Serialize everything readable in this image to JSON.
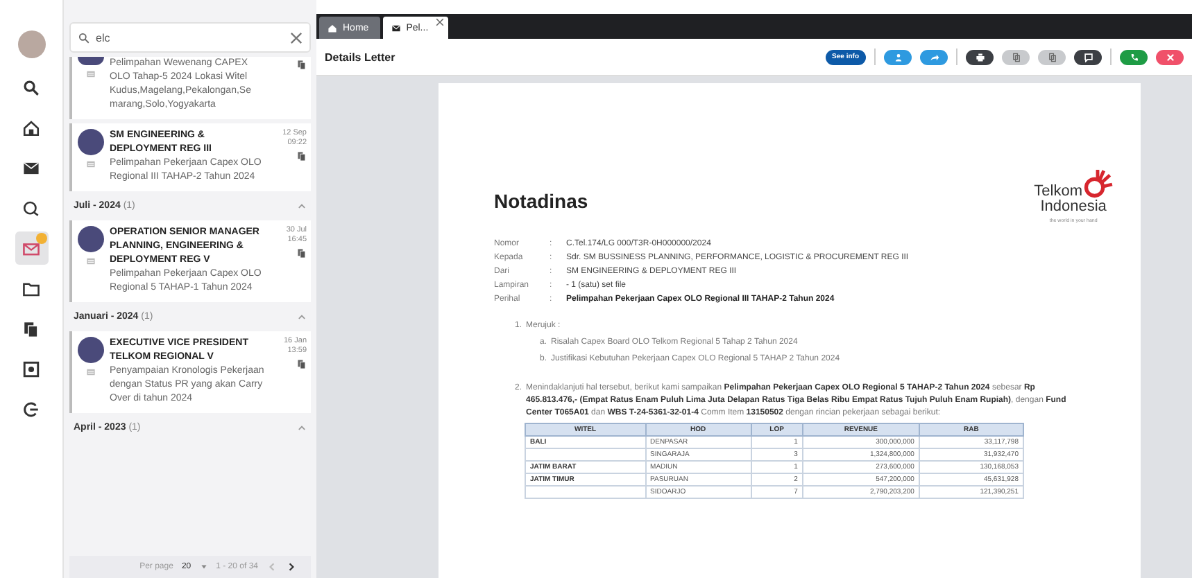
{
  "rail": {
    "items": [
      {
        "kind": "search",
        "selected": false,
        "badge": false
      },
      {
        "kind": "home",
        "selected": false,
        "badge": false
      },
      {
        "kind": "inbox",
        "selected": false,
        "badge": false
      },
      {
        "kind": "chat",
        "selected": false,
        "badge": false
      },
      {
        "kind": "mail",
        "selected": true,
        "badge": true
      },
      {
        "kind": "folder",
        "selected": false,
        "badge": false
      },
      {
        "kind": "copy",
        "selected": false,
        "badge": false
      },
      {
        "kind": "settings",
        "selected": false,
        "badge": false
      },
      {
        "kind": "logout",
        "selected": false,
        "badge": false
      }
    ]
  },
  "list": {
    "search": {
      "value": "elc"
    },
    "entries": [
      {
        "kind": "message",
        "subject": "Pelimpahan Wewenang CAPEX OLO Tahap-5 2024 Lokasi Witel Kudus,Magelang,Pekalongan,Se marang,Solo,Yogyakarta"
      },
      {
        "kind": "message",
        "sender": "SM ENGINEERING & DEPLOYMENT REG III",
        "date": "12 Sep",
        "time": "09:22",
        "subject": "Pelimpahan Pekerjaan Capex OLO Regional III TAHAP-2 Tahun 2024"
      },
      {
        "kind": "group",
        "label": "Juli - 2024",
        "count": "(1)",
        "expanded": true
      },
      {
        "kind": "message",
        "sender": "OPERATION SENIOR MANAGER PLANNING, ENGINEERING & DEPLOYMENT REG V",
        "date": "30 Jul",
        "time": "16:45",
        "subject": "Pelimpahan Pekerjaan Capex OLO Regional 5 TAHAP-1 Tahun 2024"
      },
      {
        "kind": "group",
        "label": "Januari - 2024",
        "count": "(1)",
        "expanded": true
      },
      {
        "kind": "message",
        "sender": "EXECUTIVE VICE PRESIDENT TELKOM REGIONAL V",
        "date": "16 Jan",
        "time": "13:59",
        "subject": "Penyampaian Kronologis Pekerjaan dengan Status PR yang akan Carry Over di tahun 2024"
      },
      {
        "kind": "group",
        "label": "April - 2023",
        "count": "(1)",
        "expanded": true
      }
    ],
    "pagination": {
      "label": "Per page",
      "per_page": "20",
      "range": "1 - 20 of 34"
    }
  },
  "tabs": [
    {
      "kind": "home",
      "label": "Home",
      "selected": false,
      "closable": false
    },
    {
      "kind": "letter",
      "label": "Pel...",
      "selected": true,
      "closable": true
    }
  ],
  "toolbar": {
    "title": "Details Letter",
    "buttons": [
      {
        "kind": "info",
        "label": "See info"
      },
      {
        "kind": "divider"
      },
      {
        "kind": "person"
      },
      {
        "kind": "forward"
      },
      {
        "kind": "divider"
      },
      {
        "kind": "print"
      },
      {
        "kind": "copy"
      },
      {
        "kind": "copy"
      },
      {
        "kind": "comment"
      },
      {
        "kind": "divider"
      },
      {
        "kind": "phone"
      },
      {
        "kind": "close"
      }
    ]
  },
  "document": {
    "title": "Notadinas",
    "logo": {
      "name": "Telkom",
      "sub": "Indonesia",
      "tagline": "the world in your hand"
    },
    "fields": [
      {
        "label": "Nomor",
        "colon": ":",
        "value": "C.Tel.174/LG 000/T3R-0H000000/2024",
        "bold": false
      },
      {
        "label": "Kepada",
        "colon": ":",
        "value": "Sdr. SM BUSSINESS PLANNING, PERFORMANCE, LOGISTIC & PROCUREMENT REG III",
        "bold": false
      },
      {
        "label": "Dari",
        "colon": ":",
        "value": "SM ENGINEERING & DEPLOYMENT REG III",
        "bold": false
      },
      {
        "label": "Lampiran",
        "colon": ":",
        "value": "- 1 (satu) set file",
        "bold": false
      },
      {
        "label": "Perihal",
        "colon": ":",
        "value": "Pelimpahan Pekerjaan Capex OLO Regional III TAHAP-2 Tahun 2024",
        "bold": true
      }
    ],
    "points": [
      {
        "number": "1.",
        "text": "Merujuk :",
        "subpoints": [
          {
            "letter": "a.",
            "text": "Risalah Capex Board OLO Telkom Regional 5 Tahap 2 Tahun 2024"
          },
          {
            "letter": "b.",
            "text": "Justifikasi Kebutuhan Pekerjaan Capex OLO Regional 5 TAHAP 2 Tahun 2024"
          }
        ]
      },
      {
        "number": "2.",
        "text": "Menindaklanjuti hal tersebut, berikut kami sampaikan **Pelimpahan Pekerjaan Capex OLO Regional 5 TAHAP-2 Tahun 2024** sebesar **Rp 465.813.476,- (Empat Ratus Enam Puluh Lima Juta Delapan Ratus Tiga Belas Ribu Empat Ratus Tujuh Puluh Enam Rupiah)**, dengan **Fund Center T065A01** dan **WBS T-24-5361-32-01-4** Comm Item **13150502** dengan rincian pekerjaan sebagai berikut:"
      }
    ],
    "table": {
      "columns": [
        "WITEL",
        "HOD",
        "LOP",
        "REVENUE",
        "RAB"
      ],
      "rows": [
        [
          "BALI",
          "DENPASAR",
          "1",
          "300,000,000",
          "33,117,798"
        ],
        [
          "",
          "SINGARAJA",
          "3",
          "1,324,800,000",
          "31,932,470"
        ],
        [
          "JATIM BARAT",
          "MADIUN",
          "1",
          "273,600,000",
          "130,168,053"
        ],
        [
          "JATIM TIMUR",
          "PASURUAN",
          "2",
          "547,200,000",
          "45,631,928"
        ],
        [
          "",
          "SIDOARJO",
          "7",
          "2,790,203,200",
          "121,390,251"
        ]
      ]
    }
  }
}
